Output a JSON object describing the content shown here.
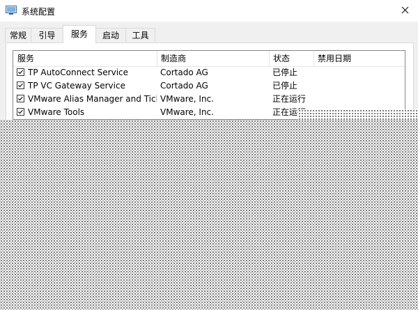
{
  "window": {
    "title": "系统配置",
    "icon": "msconfig-icon",
    "close_icon": "close-icon"
  },
  "tabs": [
    {
      "label": "常规",
      "active": false
    },
    {
      "label": "引导",
      "active": false
    },
    {
      "label": "服务",
      "active": true
    },
    {
      "label": "启动",
      "active": false
    },
    {
      "label": "工具",
      "active": false
    }
  ],
  "services_table": {
    "columns": [
      "服务",
      "制造商",
      "状态",
      "禁用日期"
    ],
    "rows": [
      {
        "checked": true,
        "service": "TP AutoConnect Service",
        "manufacturer": "Cortado AG",
        "status": "已停止",
        "disabled_date": ""
      },
      {
        "checked": true,
        "service": "TP VC Gateway Service",
        "manufacturer": "Cortado AG",
        "status": "已停止",
        "disabled_date": ""
      },
      {
        "checked": true,
        "service": "VMware Alias Manager and Tick...",
        "manufacturer": "VMware, Inc.",
        "status": "正在运行",
        "disabled_date": ""
      },
      {
        "checked": true,
        "service": "VMware Tools",
        "manufacturer": "VMware, Inc.",
        "status": "正在运行",
        "disabled_date": ""
      }
    ]
  }
}
